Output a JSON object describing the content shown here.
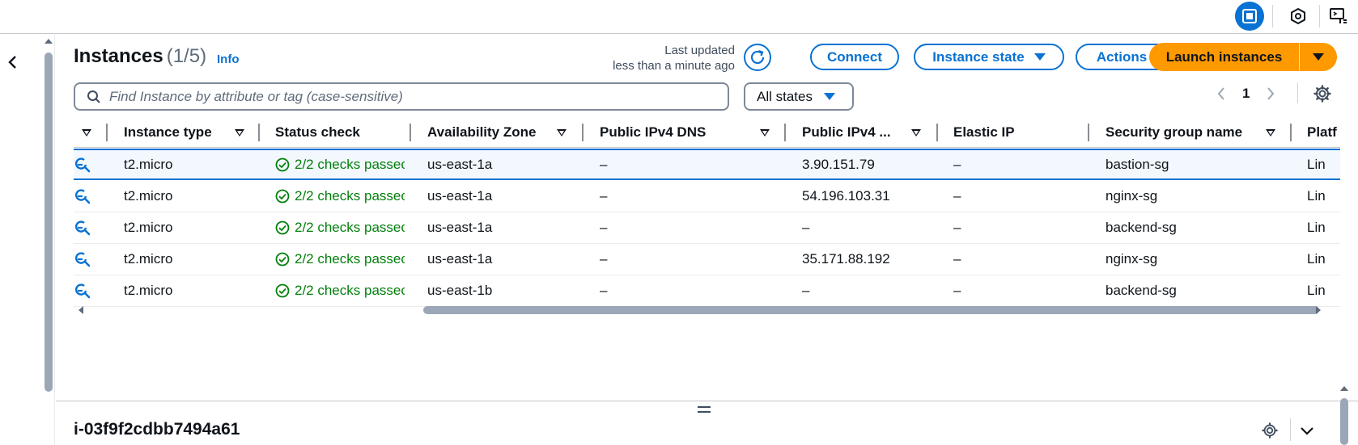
{
  "header": {
    "title": "Instances",
    "count": "(1/5)",
    "info_link": "Info",
    "last_updated_line1": "Last updated",
    "last_updated_line2": "less than a minute ago"
  },
  "actions": {
    "connect": "Connect",
    "instance_state": "Instance state",
    "actions": "Actions",
    "launch": "Launch instances"
  },
  "search": {
    "placeholder": "Find Instance by attribute or tag (case-sensitive)",
    "states_filter": "All states"
  },
  "pagination": {
    "current_page": "1"
  },
  "table": {
    "columns": [
      "Instance type",
      "Status check",
      "Availability Zone",
      "Public IPv4 DNS",
      "Public IPv4 ...",
      "Elastic IP",
      "Security group name",
      "Platf"
    ],
    "rows": [
      {
        "type": "t2.micro",
        "status": "2/2 checks passec",
        "az": "us-east-1a",
        "dns": "–",
        "ipv4": "3.90.151.79",
        "eip": "–",
        "sg": "bastion-sg",
        "platform": "Lin",
        "selected": true
      },
      {
        "type": "t2.micro",
        "status": "2/2 checks passec",
        "az": "us-east-1a",
        "dns": "–",
        "ipv4": "54.196.103.31",
        "eip": "–",
        "sg": "nginx-sg",
        "platform": "Lin",
        "selected": false
      },
      {
        "type": "t2.micro",
        "status": "2/2 checks passec",
        "az": "us-east-1a",
        "dns": "–",
        "ipv4": "–",
        "eip": "–",
        "sg": "backend-sg",
        "platform": "Lin",
        "selected": false
      },
      {
        "type": "t2.micro",
        "status": "2/2 checks passec",
        "az": "us-east-1a",
        "dns": "–",
        "ipv4": "35.171.88.192",
        "eip": "–",
        "sg": "nginx-sg",
        "platform": "Lin",
        "selected": false
      },
      {
        "type": "t2.micro",
        "status": "2/2 checks passec",
        "az": "us-east-1b",
        "dns": "–",
        "ipv4": "–",
        "eip": "–",
        "sg": "backend-sg",
        "platform": "Lin",
        "selected": false
      }
    ]
  },
  "details_panel": {
    "instance_id": "i-03f9f2cdbb7494a61"
  },
  "colors": {
    "accent": "#0972d3",
    "launch": "#ff9900",
    "success": "#037f0c",
    "selected_row_bg": "#f2f8fd"
  },
  "icons": {
    "topbar": [
      "panel-icon",
      "hexagon-icon",
      "remote-desktop-icon"
    ],
    "row": "zoom-icon",
    "status": "check-circle-icon"
  }
}
